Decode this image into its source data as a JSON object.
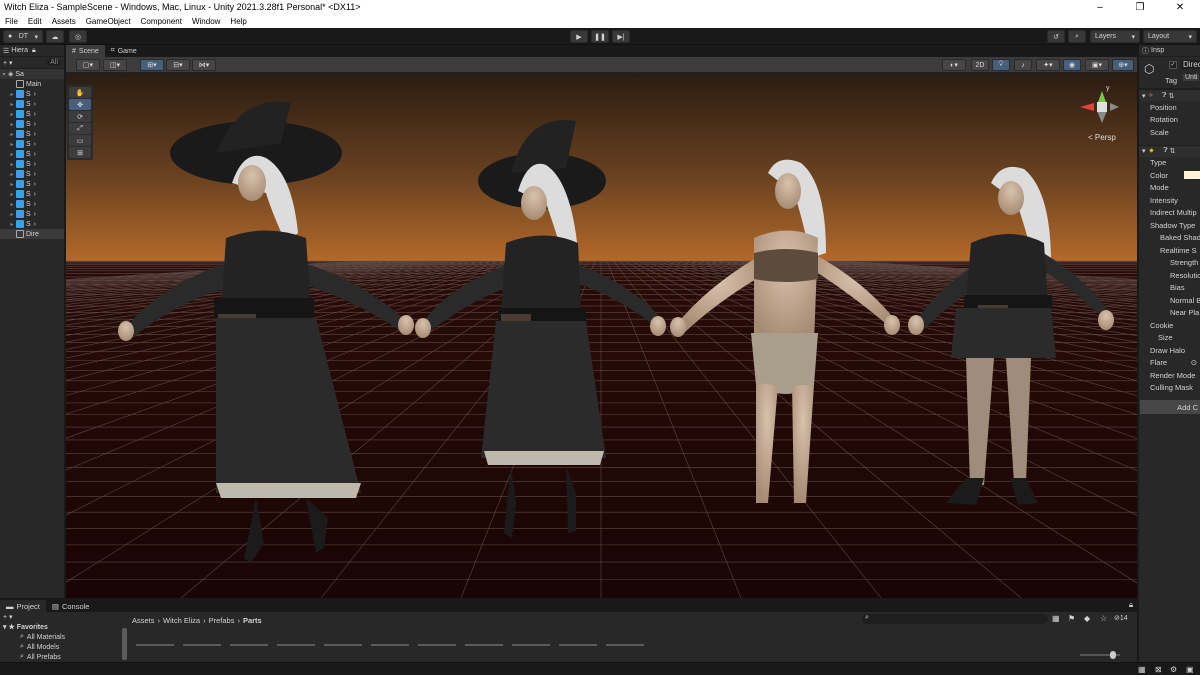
{
  "window": {
    "title": "Witch Eliza - SampleScene - Windows, Mac, Linux - Unity 2021.3.28f1 Personal* <DX11>",
    "minimize": "–",
    "maximize": "❐",
    "close": "✕"
  },
  "menu": [
    "File",
    "Edit",
    "Assets",
    "GameObject",
    "Component",
    "Window",
    "Help"
  ],
  "toolbar": {
    "account": "DT",
    "layers": "Layers",
    "layout": "Layout"
  },
  "hierarchy": {
    "tab": "Hiera",
    "search_placeholder": "All",
    "scene": "Sa",
    "items": [
      {
        "label": "Main",
        "type": "gray",
        "arrow": ""
      },
      {
        "label": "S",
        "type": "blue",
        "arrow": "▸"
      },
      {
        "label": "S",
        "type": "blue",
        "arrow": "▸"
      },
      {
        "label": "S",
        "type": "blue",
        "arrow": "▸"
      },
      {
        "label": "S",
        "type": "blue",
        "arrow": "▸"
      },
      {
        "label": "S",
        "type": "blue",
        "arrow": "▸"
      },
      {
        "label": "S",
        "type": "blue",
        "arrow": "▸"
      },
      {
        "label": "S",
        "type": "blue",
        "arrow": "▸"
      },
      {
        "label": "S",
        "type": "blue",
        "arrow": "▸"
      },
      {
        "label": "S",
        "type": "blue",
        "arrow": "▸"
      },
      {
        "label": "S",
        "type": "blue",
        "arrow": "▸"
      },
      {
        "label": "S",
        "type": "blue",
        "arrow": "▸"
      },
      {
        "label": "S",
        "type": "blue",
        "arrow": "▸"
      },
      {
        "label": "S",
        "type": "blue",
        "arrow": "▸"
      },
      {
        "label": "S",
        "type": "blue",
        "arrow": "▸"
      },
      {
        "label": "Dire",
        "type": "gray",
        "arrow": ""
      }
    ]
  },
  "scene": {
    "tabs": [
      "Scene",
      "Game"
    ],
    "view_2d": "2D",
    "persp": "< Persp",
    "axis_y": "y"
  },
  "inspector": {
    "tab": "Insp",
    "object_name": "Direc",
    "tag_label": "Tag",
    "tag_value": "Unti",
    "transform_rows": [
      "Position",
      "Rotation",
      "Scale"
    ],
    "light_rows": [
      "Type",
      "Color",
      "Mode",
      "Intensity",
      "Indirect Multip",
      "Shadow Type",
      "Baked Shad",
      "Realtime S",
      "Strength",
      "Resolutio",
      "Bias",
      "Normal B",
      "Near Pla",
      "Cookie",
      "Size",
      "Draw Halo",
      "Flare",
      "Render Mode",
      "Culling Mask"
    ],
    "add_component": "Add C"
  },
  "project": {
    "tabs": [
      "Project",
      "Console"
    ],
    "favorites_label": "Favorites",
    "favorites": [
      "All Materials",
      "All Models",
      "All Prefabs"
    ],
    "breadcrumb": [
      "Assets",
      "Witch Eliza",
      "Prefabs",
      "Parts"
    ],
    "hidden_count": "14"
  },
  "colors": {
    "accent": "#46607c",
    "selection": "#2c5d87",
    "light_color": "#fff4d6"
  }
}
